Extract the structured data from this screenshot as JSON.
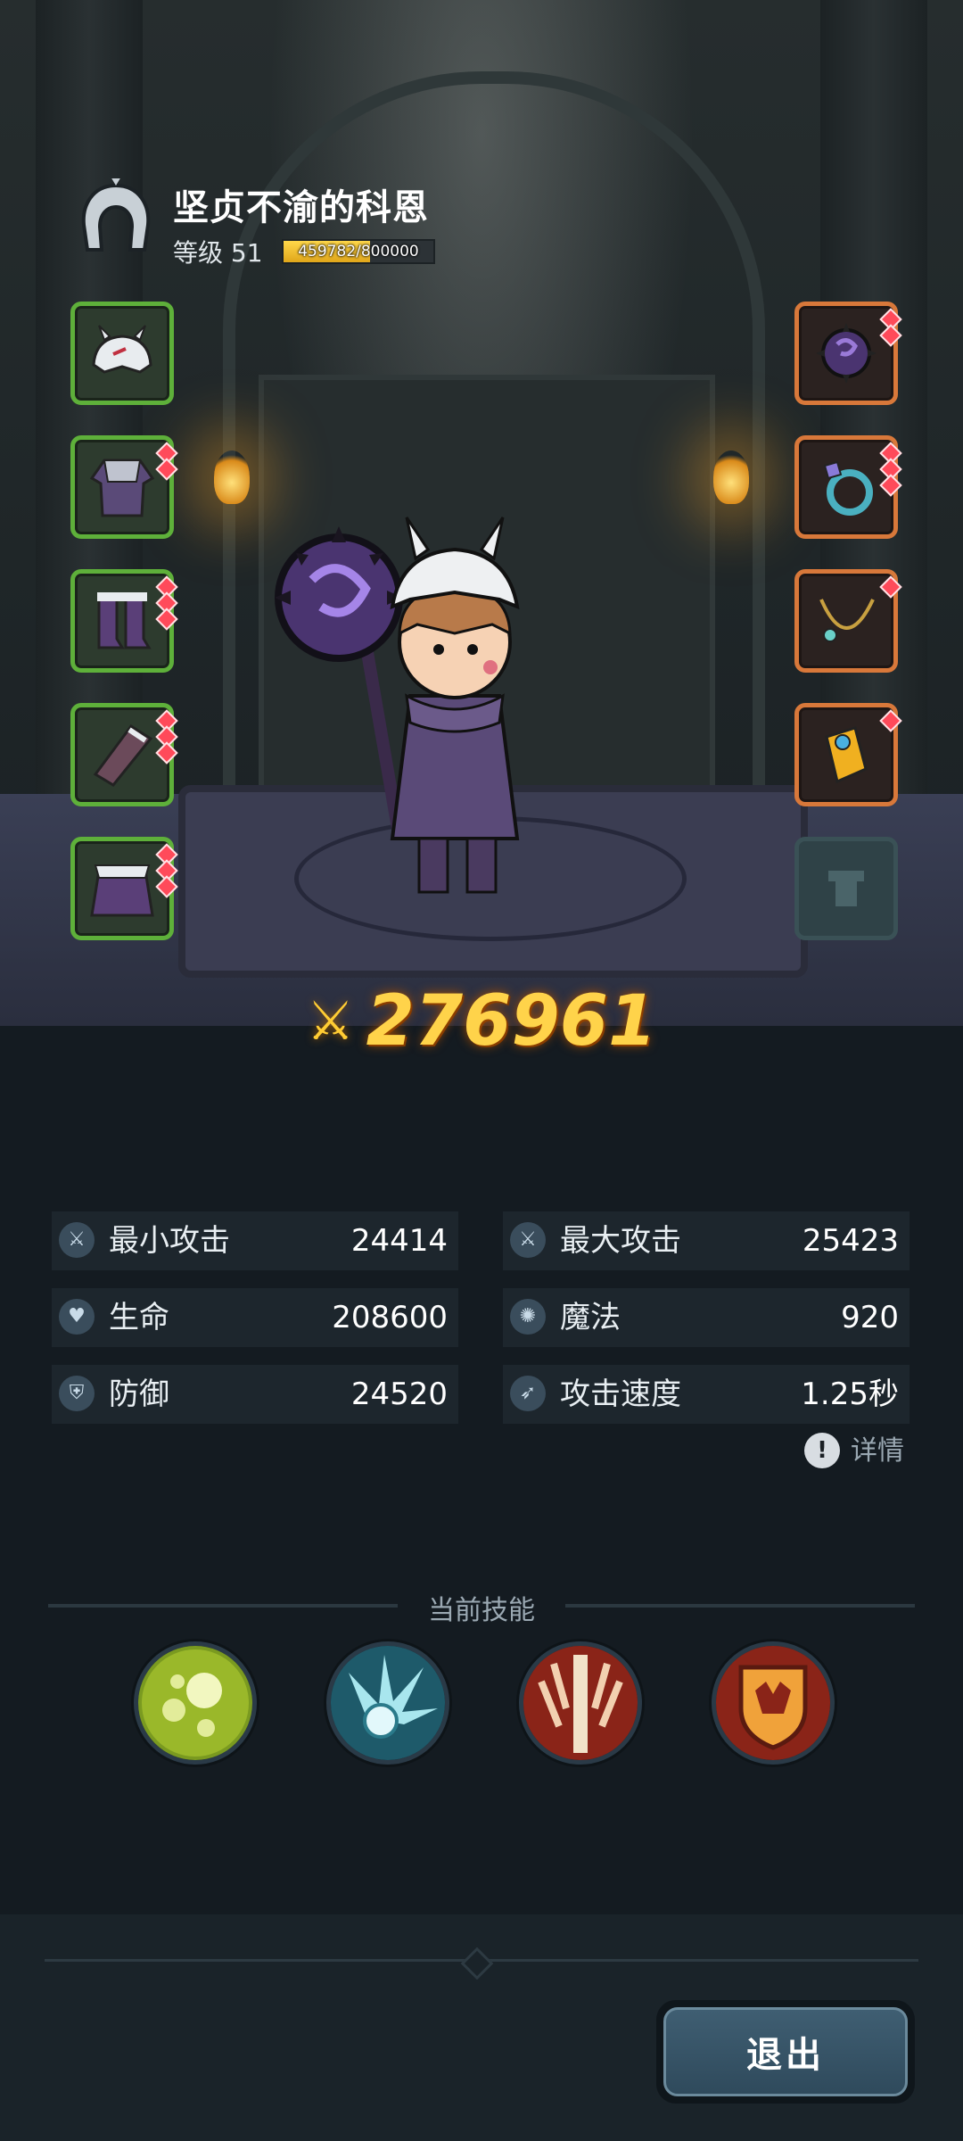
{
  "hero": {
    "name": "坚贞不渝的科恩",
    "level_label": "等级 51",
    "xp_text": "459782/800000",
    "xp_fraction": 0.575
  },
  "equipment": {
    "left": [
      {
        "name": "helmet",
        "gems": 0
      },
      {
        "name": "armor",
        "gems": 2
      },
      {
        "name": "boots",
        "gems": 3
      },
      {
        "name": "gloves",
        "gems": 3
      },
      {
        "name": "cloak",
        "gems": 3
      }
    ],
    "right": [
      {
        "name": "weapon",
        "gems": 2
      },
      {
        "name": "ring",
        "gems": 3
      },
      {
        "name": "necklace",
        "gems": 1
      },
      {
        "name": "bracelet",
        "gems": 1
      },
      {
        "name": "empty",
        "gems": 0
      }
    ]
  },
  "power": {
    "value": "276961"
  },
  "stats": {
    "min_attack": {
      "label": "最小攻击",
      "value": "24414"
    },
    "max_attack": {
      "label": "最大攻击",
      "value": "25423"
    },
    "hp": {
      "label": "生命",
      "value": "208600"
    },
    "mp": {
      "label": "魔法",
      "value": "920"
    },
    "defense": {
      "label": "防御",
      "value": "24520"
    },
    "attack_speed": {
      "label": "攻击速度",
      "value": "1.25秒"
    }
  },
  "detail_label": "详情",
  "skills": {
    "title": "当前技能"
  },
  "exit_label": "退出",
  "colors": {
    "power": "#ffd34a",
    "slot_left_border": "#5eb03a",
    "slot_right_border": "#d8783a",
    "background": "#141b21"
  }
}
